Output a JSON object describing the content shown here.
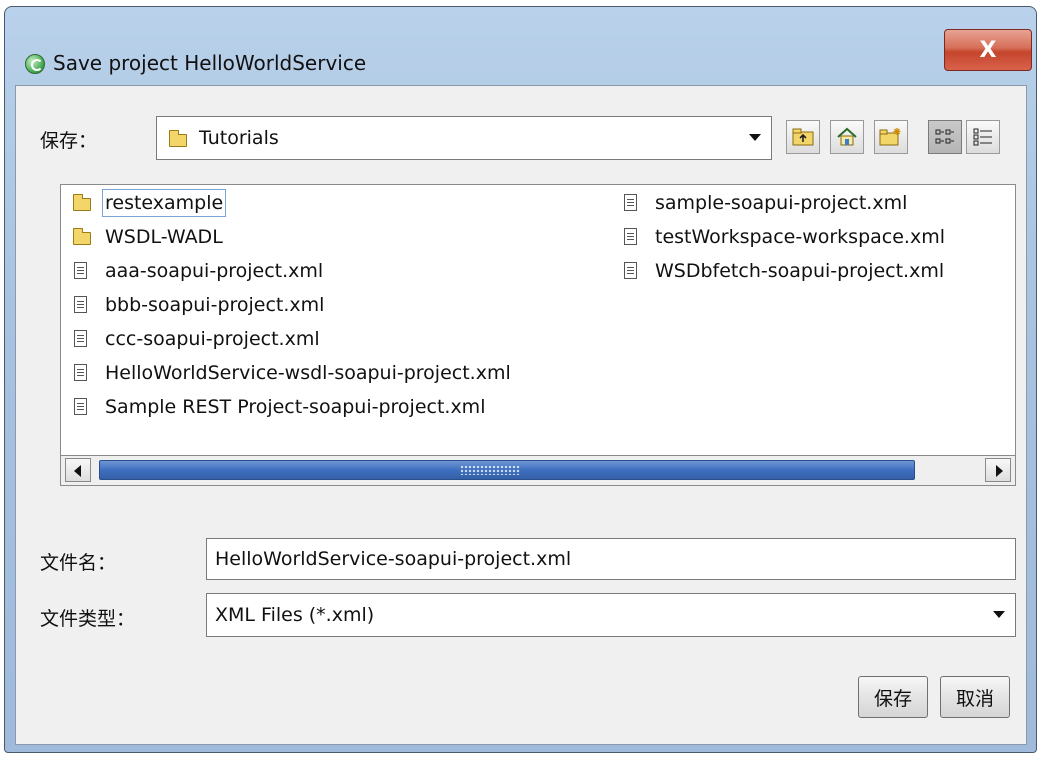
{
  "window": {
    "title": "Save project HelloWorldService",
    "close_label": "X"
  },
  "look_in": {
    "label": "保存：",
    "selected_folder": "Tutorials"
  },
  "toolbar": {
    "buttons": [
      "up-one-level",
      "home",
      "create-new-folder",
      "list-view",
      "details-view"
    ],
    "active_view": "list-view"
  },
  "file_list": {
    "items": [
      {
        "name": "restexample",
        "type": "folder",
        "selected": true
      },
      {
        "name": "WSDL-WADL",
        "type": "folder"
      },
      {
        "name": "aaa-soapui-project.xml",
        "type": "file"
      },
      {
        "name": "bbb-soapui-project.xml",
        "type": "file"
      },
      {
        "name": "ccc-soapui-project.xml",
        "type": "file"
      },
      {
        "name": "HelloWorldService-wsdl-soapui-project.xml",
        "type": "file"
      },
      {
        "name": "Sample REST Project-soapui-project.xml",
        "type": "file"
      },
      {
        "name": "sample-soapui-project.xml",
        "type": "file"
      },
      {
        "name": "testWorkspace-workspace.xml",
        "type": "file"
      },
      {
        "name": "WSDbfetch-soapui-project.xml",
        "type": "file"
      }
    ]
  },
  "file_name": {
    "label": "文件名：",
    "value": "HelloWorldService-soapui-project.xml"
  },
  "file_type": {
    "label": "文件类型：",
    "value": "XML Files (*.xml)"
  },
  "buttons": {
    "save": "保存",
    "cancel": "取消"
  },
  "colors": {
    "title_bar": "#b9d1ea",
    "close_button": "#c5452c",
    "scroll_thumb": "#3e6fbf"
  }
}
